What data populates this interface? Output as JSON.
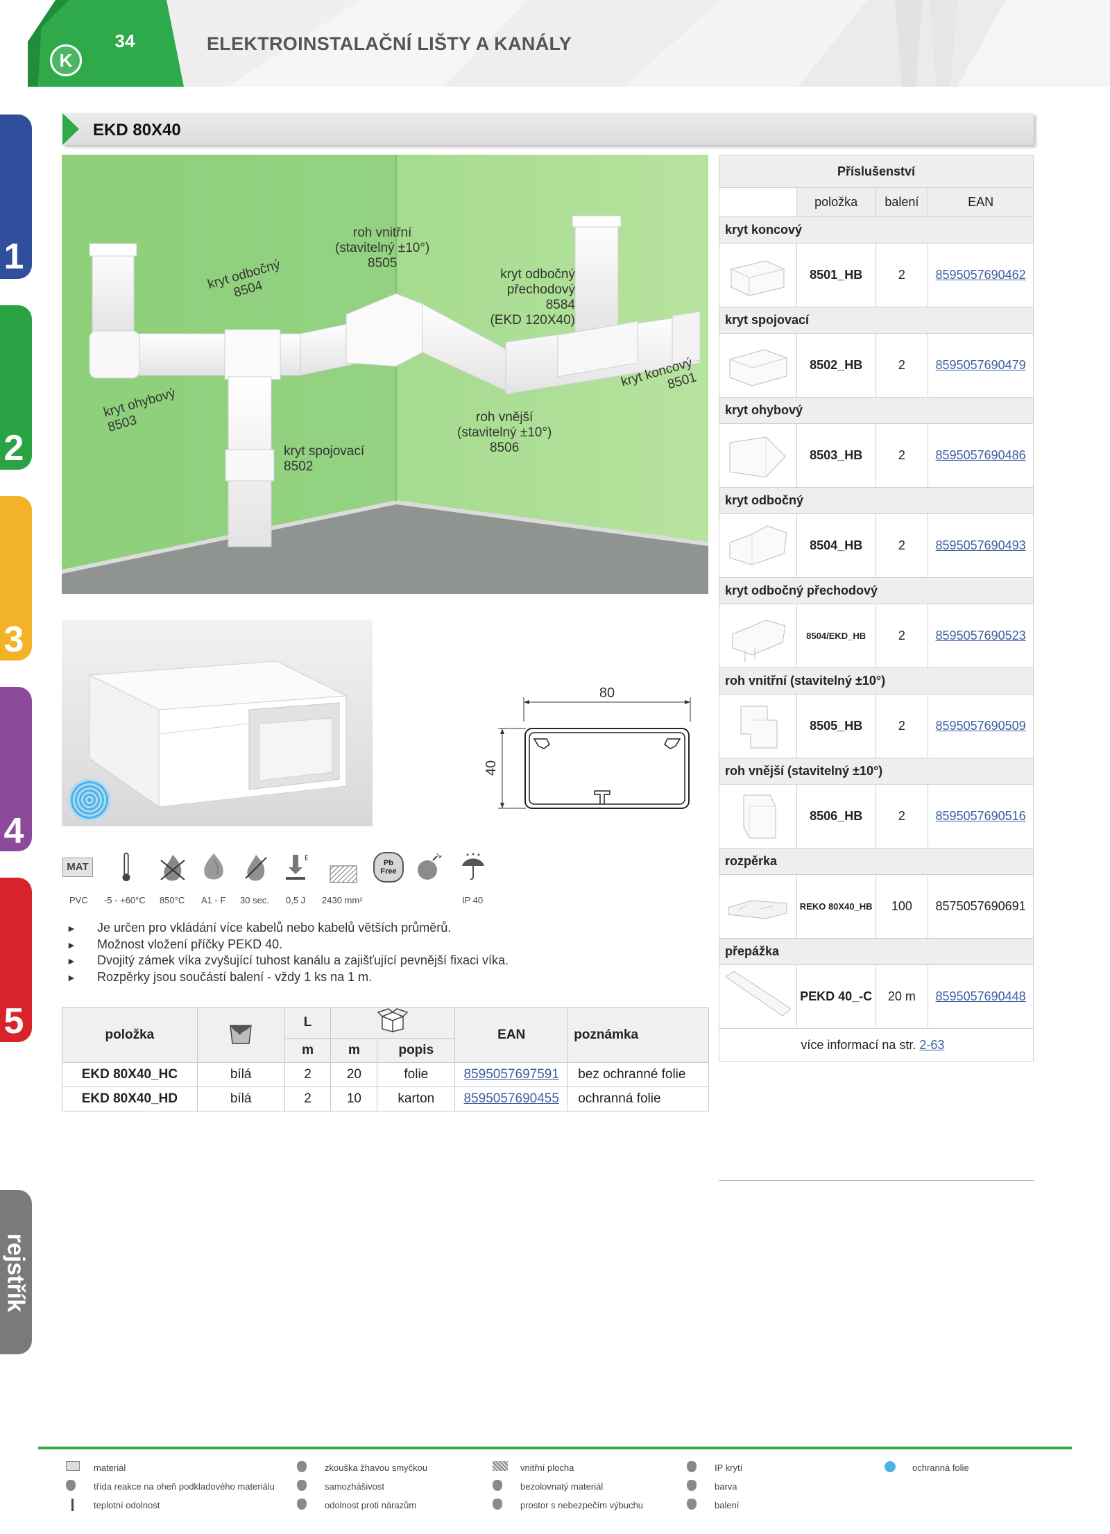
{
  "header": {
    "page_number": "34",
    "section_title": "ELEKTROINSTALAČNÍ LIŠTY A KANÁLY",
    "logo_letter": "K"
  },
  "side_tabs": [
    {
      "label": "1",
      "color": "#2f4e9b"
    },
    {
      "label": "2",
      "color": "#2aa345"
    },
    {
      "label": "3",
      "color": "#f2b328"
    },
    {
      "label": "4",
      "color": "#8b4a9a"
    },
    {
      "label": "5",
      "color": "#d8232a"
    },
    {
      "label": "rejstřík",
      "color": "#7a7a7a"
    }
  ],
  "product": {
    "title": "EKD 80X40"
  },
  "scene_labels": {
    "kryt_odbocny": "kryt odbočný",
    "kryt_odbocny_code": "8504",
    "roh_vnitrni": "roh vnitřní",
    "roh_vnitrni_range": "(stavitelný ±10°)",
    "roh_vnitrni_code": "8505",
    "kryt_prechodovy_1": "kryt odbočný",
    "kryt_prechodovy_2": "přechodový",
    "kryt_prechodovy_code": "8584",
    "kryt_prechodovy_note": "(EKD 120X40)",
    "kryt_ohybovy": "kryt ohybový",
    "kryt_ohybovy_code": "8503",
    "kryt_spojovaci": "kryt spojovací",
    "kryt_spojovaci_code": "8502",
    "roh_vnejsi": "roh vnější",
    "roh_vnejsi_range": "(stavitelný ±10°)",
    "roh_vnejsi_code": "8506",
    "kryt_koncovy": "kryt koncový",
    "kryt_koncovy_code": "8501"
  },
  "dimensions": {
    "width": "80",
    "height": "40"
  },
  "properties": {
    "mat_icon_text": "MAT",
    "pb_free_icon_text": "Pb\nFree",
    "values": [
      "PVC",
      "-5 - +60°C",
      "850°C",
      "A1 - F",
      "30 sec.",
      "0,5 J",
      "2430 mm²",
      "IP 40"
    ],
    "icons": [
      "material-icon",
      "thermometer-icon",
      "glow-wire-icon",
      "flame-drop-icon",
      "self-extinguish-icon",
      "impact-icon",
      "inner-area-icon",
      "lead-free-icon",
      "explosion-icon",
      "ip-rating-icon"
    ]
  },
  "bullets": [
    "Je určen pro vkládání více kabelů nebo kabelů větších průměrů.",
    "Možnost vložení příčky PEKD 40.",
    "Dvojitý zámek víka zvyšující tuhost kanálu a zajišťující pevnější fixaci víka.",
    "Rozpěrky jsou součástí balení - vždy 1 ks na 1 m."
  ],
  "main_table": {
    "headers": {
      "item": "položka",
      "length": "L",
      "length_unit": "m",
      "pack_unit": "m",
      "pack_desc": "popis",
      "ean": "EAN",
      "note": "poznámka"
    },
    "rows": [
      {
        "item": "EKD 80X40_HC",
        "color": "bílá",
        "length": "2",
        "pack": "20",
        "desc": "folie",
        "ean": "8595057697591",
        "note": "bez ochranné folie"
      },
      {
        "item": "EKD 80X40_HD",
        "color": "bílá",
        "length": "2",
        "pack": "10",
        "desc": "karton",
        "ean": "8595057690455",
        "note": "ochranná folie"
      }
    ]
  },
  "accessories": {
    "title": "Příslušenství",
    "headers": {
      "item": "položka",
      "pack": "balení",
      "ean": "EAN"
    },
    "groups": [
      {
        "category": "kryt koncový",
        "code": "8501_HB",
        "pack": "2",
        "ean": "8595057690462",
        "link": true
      },
      {
        "category": "kryt spojovací",
        "code": "8502_HB",
        "pack": "2",
        "ean": "8595057690479",
        "link": true
      },
      {
        "category": "kryt ohybový",
        "code": "8503_HB",
        "pack": "2",
        "ean": "8595057690486",
        "link": true
      },
      {
        "category": "kryt odbočný",
        "code": "8504_HB",
        "pack": "2",
        "ean": "8595057690493",
        "link": true
      },
      {
        "category": "kryt odbočný přechodový",
        "code": "8504/EKD_HB",
        "pack": "2",
        "ean": "8595057690523",
        "link": true
      },
      {
        "category": "roh vnitřní (stavitelný ±10°)",
        "code": "8505_HB",
        "pack": "2",
        "ean": "8595057690509",
        "link": true
      },
      {
        "category": "roh vnější (stavitelný ±10°)",
        "code": "8506_HB",
        "pack": "2",
        "ean": "8595057690516",
        "link": true
      },
      {
        "category": "rozpěrka",
        "code": "REKO 80X40_HB",
        "pack": "100",
        "ean": "8575057690691",
        "link": false
      },
      {
        "category": "přepážka",
        "code": "PEKD 40_-C",
        "pack": "20 m",
        "ean": "8595057690448",
        "link": true
      }
    ],
    "more_info_prefix": "více informací na str.",
    "more_info_link": "2-63"
  },
  "footer_legend": [
    {
      "icon": "material-icon",
      "label": "materiál"
    },
    {
      "icon": "flame-drop-icon",
      "label": "třída reakce na oheň podkladového materiálu"
    },
    {
      "icon": "thermometer-icon",
      "label": "teplotní odolnost"
    },
    {
      "icon": "glow-wire-icon",
      "label": "zkouška žhavou smyčkou"
    },
    {
      "icon": "self-extinguish-icon",
      "label": "samozhášivost"
    },
    {
      "icon": "impact-icon",
      "label": "odolnost proti nárazům"
    },
    {
      "icon": "inner-area-icon",
      "label": "vnitřní plocha"
    },
    {
      "icon": "lead-free-icon",
      "label": "bezolovnatý materiál"
    },
    {
      "icon": "explosion-icon",
      "label": "prostor s nebezpečím výbuchu"
    },
    {
      "icon": "ip-rating-icon",
      "label": "IP krytí"
    },
    {
      "icon": "color-icon",
      "label": "barva"
    },
    {
      "icon": "package-icon",
      "label": "balení"
    },
    {
      "icon": "protective-film-icon",
      "label": "ochranná folie"
    }
  ],
  "colors": {
    "brand_green": "#2eaa4a",
    "wall_green": "#8fd07a",
    "link_blue": "#3d5fa3"
  }
}
